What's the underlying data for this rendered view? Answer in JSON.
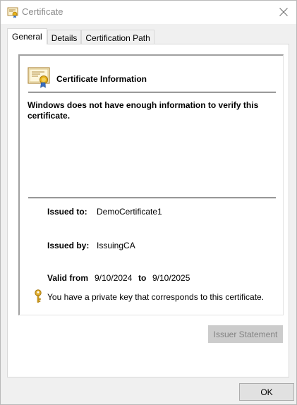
{
  "window": {
    "title": "Certificate"
  },
  "tabs": [
    {
      "label": "General",
      "active": true
    },
    {
      "label": "Details",
      "active": false
    },
    {
      "label": "Certification Path",
      "active": false
    }
  ],
  "general": {
    "heading": "Certificate Information",
    "warning": "Windows does not have enough information to verify this certificate.",
    "issued_to_label": "Issued to:",
    "issued_to_value": "DemoCertificate1",
    "issued_by_label": "Issued by:",
    "issued_by_value": "IssuingCA",
    "valid_from_label": "Valid from",
    "valid_from_value": "9/10/2024",
    "valid_to_label": "to",
    "valid_to_value": "9/10/2025",
    "private_key_note": "You have a private key that corresponds to this certificate."
  },
  "buttons": {
    "issuer_statement": "Issuer Statement",
    "ok": "OK"
  },
  "icons": {
    "title": "certificate-icon",
    "close": "close-icon",
    "cert": "certificate-icon",
    "key": "key-icon"
  },
  "colors": {
    "disabled_button_bg": "#cccccc",
    "disabled_button_text": "#838383",
    "key_gold": "#d9a520"
  }
}
